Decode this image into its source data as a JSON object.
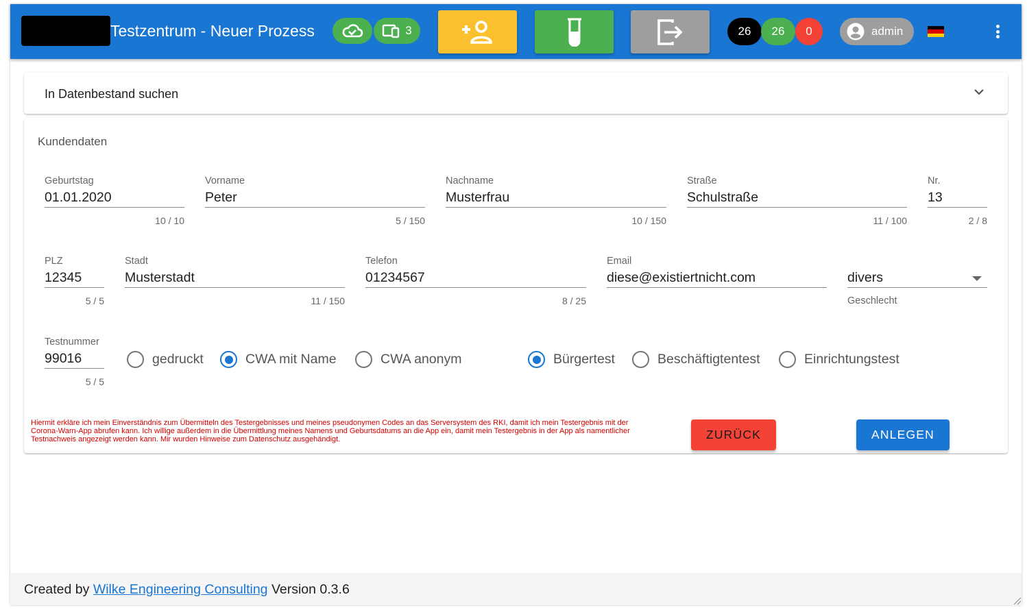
{
  "appbar": {
    "title": "Testzentrum - Neuer Prozess",
    "devices_count": "3",
    "counters": {
      "total": "26",
      "ok": "26",
      "failed": "0"
    },
    "user": "admin",
    "colors": {
      "bar": "#1976d2",
      "yellow": "#fbc02d",
      "green": "#4caf50",
      "grey": "#9e9e9e",
      "red": "#f44336"
    },
    "icons": [
      "cloud-check-icon",
      "devices-icon",
      "add-person-icon",
      "test-tube-icon",
      "exit-icon",
      "account-circle-icon",
      "german-flag-icon",
      "more-vert-icon"
    ]
  },
  "search_panel": {
    "label": "In Datenbestand suchen"
  },
  "card": {
    "title": "Kundendaten",
    "fields": {
      "birthday": {
        "label": "Geburtstag",
        "value": "01.01.2020",
        "counter": "10 / 10"
      },
      "firstname": {
        "label": "Vorname",
        "value": "Peter",
        "counter": "5 / 150"
      },
      "lastname": {
        "label": "Nachname",
        "value": "Musterfrau",
        "counter": "10 / 150"
      },
      "street": {
        "label": "Straße",
        "value": "Schulstraße",
        "counter": "11 / 100"
      },
      "number": {
        "label": "Nr.",
        "value": "13",
        "counter": "2 / 8"
      },
      "zip": {
        "label": "PLZ",
        "value": "12345",
        "counter": "5 / 5"
      },
      "city": {
        "label": "Stadt",
        "value": "Musterstadt",
        "counter": "11 / 150"
      },
      "phone": {
        "label": "Telefon",
        "value": "01234567",
        "counter": "8 / 25"
      },
      "email": {
        "label": "Email",
        "value": "diese@existiertnicht.com"
      },
      "gender": {
        "value": "divers",
        "hint": "Geschlecht"
      },
      "testnumber": {
        "label": "Testnummer",
        "value": "99016",
        "counter": "5 / 5"
      }
    },
    "result_options": [
      {
        "label": "gedruckt",
        "checked": false
      },
      {
        "label": "CWA mit Name",
        "checked": true
      },
      {
        "label": "CWA anonym",
        "checked": false
      }
    ],
    "test_type_options": [
      {
        "label": "Bürgertest",
        "checked": true
      },
      {
        "label": "Beschäftigtentest",
        "checked": false
      },
      {
        "label": "Einrichtungstest",
        "checked": false
      }
    ],
    "consent": "Hiermit erkläre ich mein Einverständnis zum Übermitteln des Testergebnisses und meines pseudonymen Codes an das Serversystem des RKI, damit ich mein Testergebnis mit der Corona-Warn-App abrufen kann. Ich willige außerdem in die Übermittlung meines Namens und Geburtsdatums an die App ein, damit mein Testergebnis in der App als namentlicher Testnachweis angezeigt werden kann. Mir wurden Hinweise zum Datenschutz ausgehändigt.",
    "back_label": "ZURÜCK",
    "create_label": "ANLEGEN"
  },
  "footer": {
    "prefix": "Created by",
    "link": "Wilke Engineering Consulting",
    "version": "Version 0.3.6"
  }
}
